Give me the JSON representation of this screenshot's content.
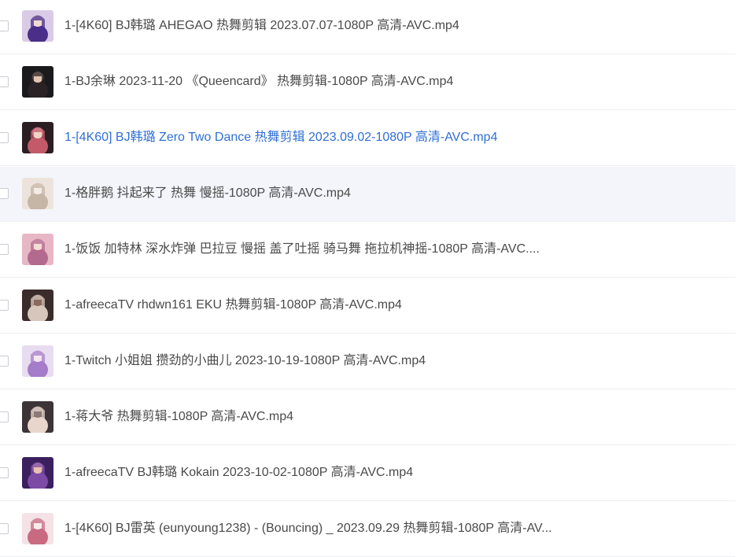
{
  "files": [
    {
      "name": "1-[4K60] BJ韩璐 AHEGAO 热舞剪辑 2023.07.07-1080P 高清-AVC.mp4",
      "thumb_icon": "video-thumbnail",
      "colors": [
        "#d9cbe6",
        "#4a2e8a",
        "#f0dcd2"
      ]
    },
    {
      "name": "1-BJ余琳 2023-11-20 《Queencard》 热舞剪辑-1080P 高清-AVC.mp4",
      "thumb_icon": "video-thumbnail",
      "colors": [
        "#1a1a1c",
        "#2a2224",
        "#e2c3b2"
      ]
    },
    {
      "name": "1-[4K60] BJ韩璐 Zero Two Dance 热舞剪辑 2023.09.02-1080P 高清-AVC.mp4",
      "thumb_icon": "video-thumbnail",
      "colors": [
        "#2a1e22",
        "#c25a6a",
        "#f1d2c6"
      ]
    },
    {
      "name": "1-格胖鹅 抖起来了 热舞 慢摇-1080P 高清-AVC.mp4",
      "thumb_icon": "video-thumbnail",
      "colors": [
        "#ece4dc",
        "#c6b6a6",
        "#f4ece4"
      ]
    },
    {
      "name": "1-饭饭 加特林 深水炸弹 巴拉豆 慢摇 盖了吐摇 骑马舞 拖拉机神摇-1080P 高清-AVC....",
      "thumb_icon": "video-thumbnail",
      "colors": [
        "#e8b7c6",
        "#b26a8e",
        "#f6dbd6"
      ]
    },
    {
      "name": "1-afreecaTV rhdwn161 EKU 热舞剪辑-1080P 高清-AVC.mp4",
      "thumb_icon": "video-thumbnail",
      "colors": [
        "#3a2c2a",
        "#d6c6bc",
        "#8a6a5c"
      ]
    },
    {
      "name": "1-Twitch 小姐姐 攒劲的小曲儿 2023-10-19-1080P 高清-AVC.mp4",
      "thumb_icon": "video-thumbnail",
      "colors": [
        "#e8dcf0",
        "#a57cc9",
        "#f3e6ee"
      ]
    },
    {
      "name": "1-蒋大爷 热舞剪辑-1080P 高清-AVC.mp4",
      "thumb_icon": "video-thumbnail",
      "colors": [
        "#3c3436",
        "#e8d6cc",
        "#8c7a76"
      ]
    },
    {
      "name": "1-afreecaTV BJ韩璐 Kokain 2023-10-02-1080P 高清-AVC.mp4",
      "thumb_icon": "video-thumbnail",
      "colors": [
        "#3b1f5e",
        "#7d4aa6",
        "#e6c0b0"
      ]
    },
    {
      "name": "1-[4K60] BJ雷英 (eunyoung1238) - (Bouncing) _ 2023.09.29 热舞剪辑-1080P 高清-AV...",
      "thumb_icon": "video-thumbnail",
      "colors": [
        "#f4e2e6",
        "#c86a80",
        "#f8ecea"
      ]
    }
  ],
  "active_index": 2,
  "hover_index": 3,
  "colors": {
    "text": "#4a4a4a",
    "active_text": "#2f6fd6",
    "hover_bg": "#f3f5fb",
    "divider": "#eeeff2"
  }
}
